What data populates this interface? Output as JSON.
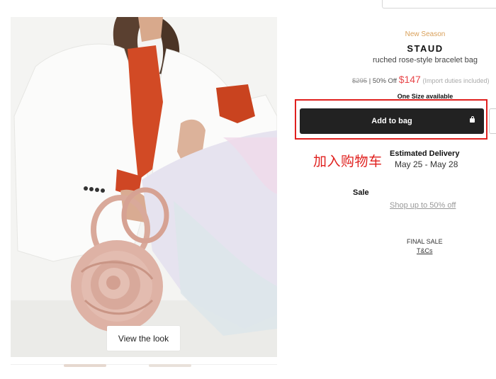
{
  "product": {
    "season_label": "New Season",
    "brand": "STAUD",
    "name": "ruched rose-style bracelet bag",
    "original_price": "$295",
    "discount": "| 50% Off",
    "sale_price": "$147",
    "duties_note": "(Import duties included)",
    "size_availability": "One Size available"
  },
  "actions": {
    "add_to_bag_label": "Add to bag",
    "view_look_label": "View the look"
  },
  "annotation": {
    "text": "加入购物车",
    "color": "#e0201e"
  },
  "delivery": {
    "title": "Estimated Delivery",
    "dates": "May 25 - May 28"
  },
  "sale": {
    "title": "Sale",
    "link_text": "Shop up to 50% off"
  },
  "terms": {
    "final_sale": "FINAL SALE",
    "tcs_link": "T&Cs"
  },
  "colors": {
    "sale_price": "#e8474a",
    "season_label": "#d9a05a",
    "add_to_bag_bg": "#222222",
    "highlight": "#e0201e"
  }
}
